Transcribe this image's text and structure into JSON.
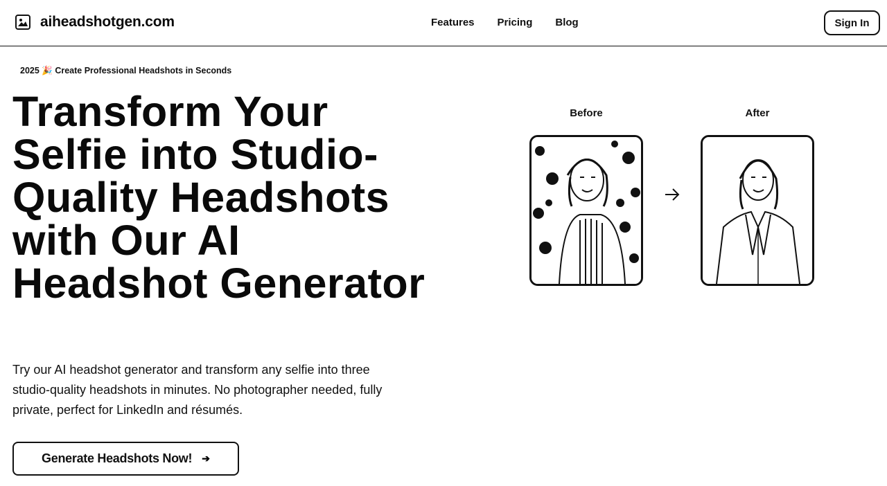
{
  "header": {
    "brand": "aiheadshotgen.com",
    "logo_icon": "image-icon",
    "nav": [
      "Features",
      "Pricing",
      "Blog"
    ],
    "sign_in": "Sign In"
  },
  "hero": {
    "badge": "2025 🎉 Create Professional Headshots in Seconds",
    "title": "Transform Your Selfie into Studio-Quality Headshots with Our AI Headshot Generator",
    "subtitle": "Try our AI headshot generator and transform any selfie into three studio-quality headshots in minutes. No photographer needed, fully private, perfect for LinkedIn and résumés.",
    "cta_label": "Generate Headshots Now!",
    "cta_icon": "arrow-right-icon"
  },
  "comparison": {
    "before_label": "Before",
    "after_label": "After",
    "arrow_icon": "arrow-right-icon"
  }
}
